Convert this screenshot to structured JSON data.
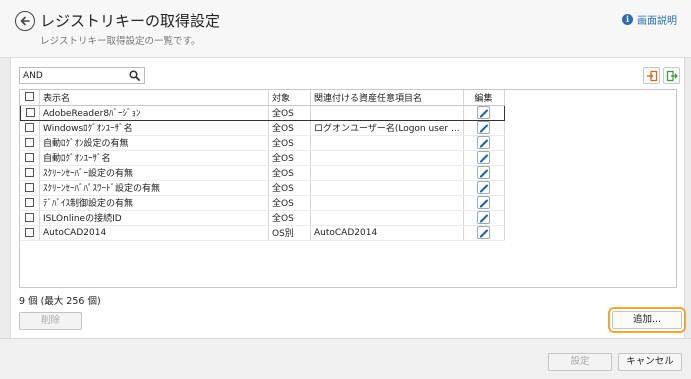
{
  "header": {
    "title": "レジストリキーの取得設定",
    "subtitle": "レジストリキー取得設定の一覧です。",
    "help_label": "画面説明",
    "back_icon": "back-circle-arrow"
  },
  "search": {
    "value": "AND",
    "icon": "search-icon"
  },
  "toolbar": {
    "import_icon": "import-icon",
    "export_icon": "export-icon",
    "accent_color": "#f0a830"
  },
  "table": {
    "columns": [
      "表示名",
      "対象",
      "関連付ける資産任意項目名",
      "編集"
    ],
    "rows": [
      {
        "name": "AdobeReader8ﾊﾞｰｼﾞｮﾝ",
        "target": "全OS",
        "field": "",
        "selected": true
      },
      {
        "name": "Windowsﾛｸﾞｵﾝﾕｰｻﾞ名",
        "target": "全OS",
        "field": "ログオンユーザー名(Logon user ...",
        "selected": false
      },
      {
        "name": "自動ﾛｸﾞｵﾝ設定の有無",
        "target": "全OS",
        "field": "",
        "selected": false
      },
      {
        "name": "自動ﾛｸﾞｵﾝﾕｰｻﾞ名",
        "target": "全OS",
        "field": "",
        "selected": false
      },
      {
        "name": "ｽｸﾘｰﾝｾｰﾊﾞｰ設定の有無",
        "target": "全OS",
        "field": "",
        "selected": false
      },
      {
        "name": "ｽｸﾘｰﾝｾｰﾊﾞﾊﾟｽﾜｰﾄﾞ設定の有無",
        "target": "全OS",
        "field": "",
        "selected": false
      },
      {
        "name": "ﾃﾞﾊﾞｲｽ制御設定の有無",
        "target": "全OS",
        "field": "",
        "selected": false
      },
      {
        "name": "ISLOnlineの接続ID",
        "target": "全OS",
        "field": "",
        "selected": false
      },
      {
        "name": "AutoCAD2014",
        "target": "OS別",
        "field": "AutoCAD2014",
        "selected": false
      }
    ]
  },
  "count_text": "9 個 (最大 256 個)",
  "buttons": {
    "delete": "削除",
    "add": "追加...",
    "set": "設定",
    "cancel": "キャンセル"
  }
}
